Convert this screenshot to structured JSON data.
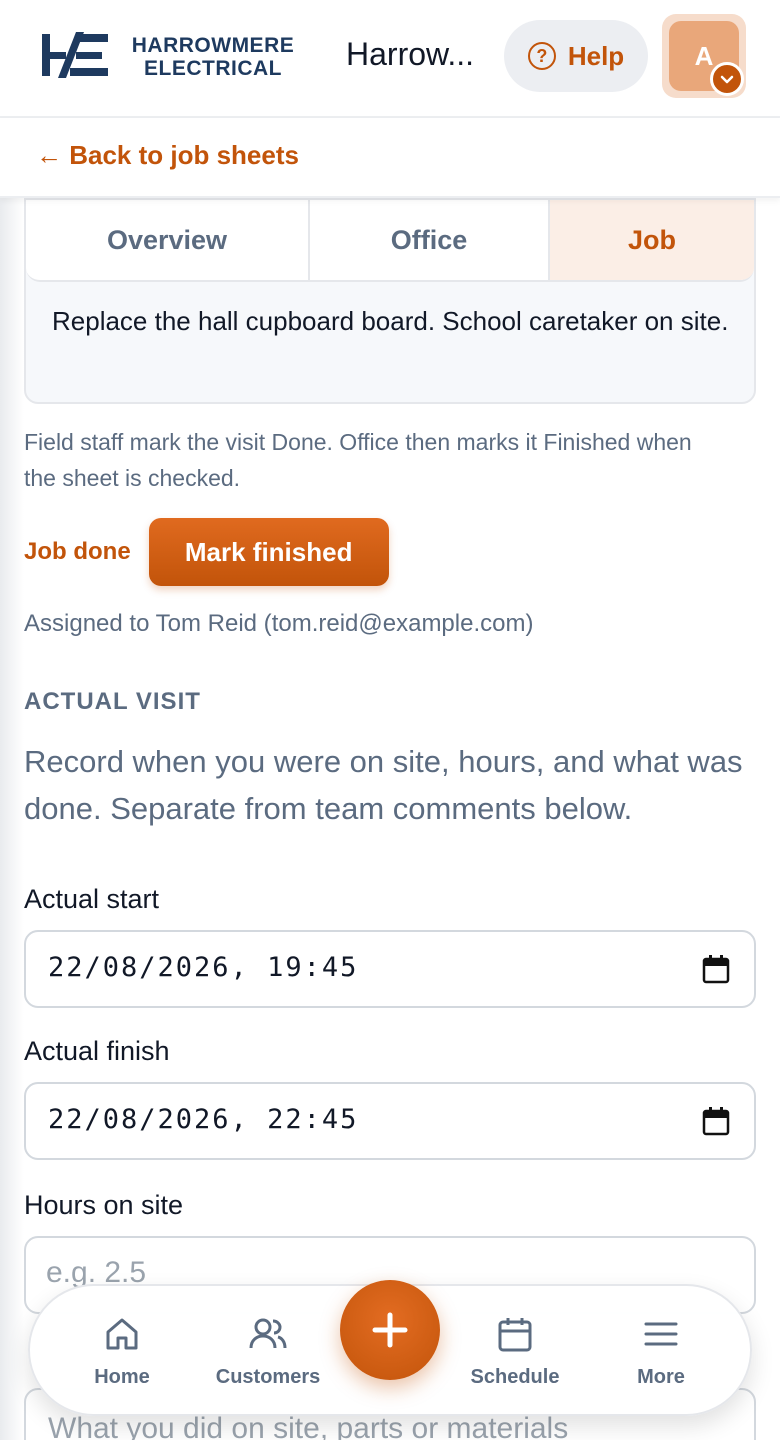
{
  "brand": {
    "line1": "HARROWMERE",
    "line2": "ELECTRICAL",
    "app_title": "Harrow..."
  },
  "header": {
    "help_label": "Help",
    "avatar_initial": "A"
  },
  "nav": {
    "back_label": "← Back to job sheets"
  },
  "tabs": [
    {
      "label": "Overview",
      "active": false
    },
    {
      "label": "Office",
      "active": false
    },
    {
      "label": "Job",
      "active": true
    }
  ],
  "job": {
    "description": "Replace the hall cupboard board. School caretaker on site.",
    "note": "Field staff mark the visit Done. Office then marks it Finished when the sheet is checked.",
    "status_label": "Job done",
    "finish_button": "Mark finished",
    "assigned_prefix": "Assigned to Tom Reid (",
    "assigned_email": "tom.reid@example.com",
    "assigned_suffix": ")"
  },
  "actual_visit": {
    "heading": "ACTUAL VISIT",
    "description": "Record when you were on site, hours, and what was done. Separate from team comments below.",
    "start_label": "Actual start",
    "start_value": "22/08/2026, 19:45",
    "finish_label": "Actual finish",
    "finish_value": "22/08/2026, 22:45",
    "hours_label": "Hours on site",
    "hours_placeholder": "e.g. 2.5",
    "work_placeholder": "What you did on site, parts or materials"
  },
  "bottom_nav": {
    "items": [
      {
        "label": "Home",
        "icon": "home-icon"
      },
      {
        "label": "Customers",
        "icon": "users-icon"
      },
      {
        "label": "Schedule",
        "icon": "calendar-icon"
      },
      {
        "label": "More",
        "icon": "menu-icon"
      }
    ],
    "fab_icon": "plus-icon"
  },
  "colors": {
    "accent": "#c2540a",
    "brand_navy": "#1e3a5f",
    "muted_text": "#5b6b80"
  }
}
